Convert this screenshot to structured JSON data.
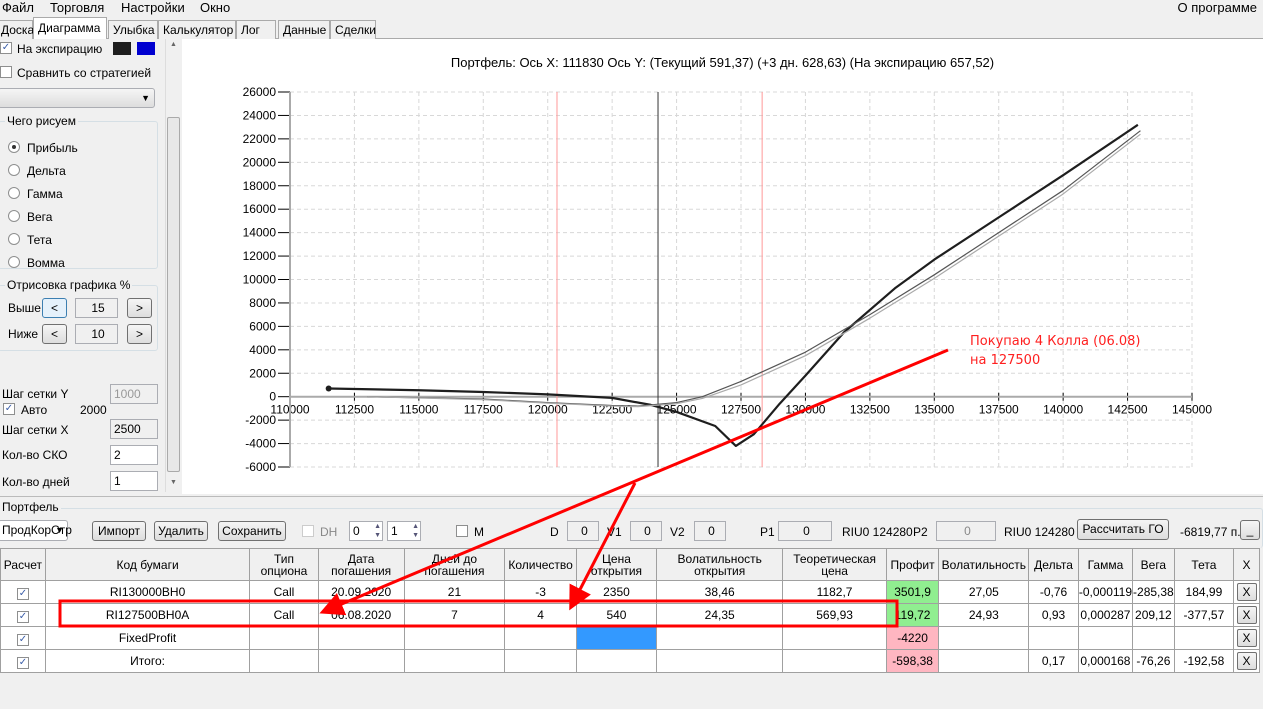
{
  "menu": [
    "Файл",
    "Торговля",
    "Настройки",
    "Окно"
  ],
  "about": "О программе",
  "tabs": [
    "Доска",
    "Диаграмма",
    "Улыбка",
    "Калькулятор",
    "Лог",
    "Данные",
    "Сделки"
  ],
  "active_tab": "Диаграмма",
  "left": {
    "expiration_label": "На экспирацию",
    "expiration_checked": true,
    "colors": [
      "#1e1e1e",
      "#0000d0"
    ],
    "compare_label": "Сравнить со стратегией",
    "compare_checked": false,
    "dropdown_value": "",
    "draw_group": "Чего рисуем",
    "radios": [
      "Прибыль",
      "Дельта",
      "Гамма",
      "Вега",
      "Тета",
      "Вомма"
    ],
    "radio_selected": "Прибыль",
    "render_group": "Отрисовка графика %",
    "above_label": "Выше",
    "above_value": "15",
    "below_label": "Ниже",
    "below_value": "10",
    "prev": "<",
    "next": ">",
    "grid_y_label": "Шаг сетки Y",
    "grid_y_value": "1000",
    "auto_label": "Авто",
    "auto_checked": true,
    "auto_value": "2000",
    "grid_x_label": "Шаг сетки X",
    "grid_x_value": "2500",
    "sko_label": "Кол-во СКО",
    "sko_value": "2",
    "days_label": "Кол-во дней",
    "days_value": "1"
  },
  "chart_data": {
    "type": "line",
    "title": "Портфель: Ось X: 111830 Ось Y:  (Текущий 591,37)  (+3 дн. 628,63)  (На экспирацию 657,52)",
    "xlim": [
      110000,
      145000
    ],
    "ylim": [
      -6000,
      26000
    ],
    "xticks": [
      "110000",
      "112500",
      "115000",
      "117500",
      "120000",
      "122500",
      "125000",
      "127500",
      "130000",
      "132500",
      "135000",
      "137500",
      "140000",
      "142500",
      "145000"
    ],
    "yticks": [
      "26000",
      "24000",
      "22000",
      "20000",
      "18000",
      "16000",
      "14000",
      "12000",
      "10000",
      "8000",
      "6000",
      "4000",
      "2000",
      "0",
      "-2000",
      "-4000",
      "-6000"
    ],
    "grid": true,
    "vlines": [
      {
        "x": 120360,
        "color": "#ff9999"
      },
      {
        "x": 124280,
        "color": "#333333"
      },
      {
        "x": 128320,
        "color": "#ff9999"
      }
    ],
    "series": [
      {
        "color": "#1e1e1e",
        "x": [
          111500,
          115000,
          117500,
          120000,
          122500,
          124000,
          125000,
          126500,
          127300,
          128000,
          129000,
          130000,
          131500,
          133500,
          135000,
          137500,
          140000,
          142900
        ],
        "y": [
          700,
          550,
          400,
          200,
          -100,
          -700,
          -1300,
          -2500,
          -4200,
          -3200,
          -600,
          1800,
          5500,
          9300,
          11700,
          15300,
          18900,
          23200
        ]
      },
      {
        "color": "#555555",
        "x": [
          113000,
          117500,
          120000,
          122500,
          123500,
          125000,
          126000,
          127500,
          130000,
          132500,
          135000,
          137500,
          140000,
          143000
        ],
        "y": [
          0,
          -200,
          -500,
          -750,
          -800,
          -500,
          0,
          1300,
          3800,
          7000,
          10400,
          14000,
          17600,
          22700
        ]
      },
      {
        "color": "#aaaaaa",
        "x": [
          113000,
          117500,
          120000,
          122500,
          123500,
          125000,
          126000,
          127500,
          130000,
          132500,
          135000,
          137500,
          140000,
          143000
        ],
        "y": [
          0,
          -250,
          -550,
          -800,
          -850,
          -600,
          -150,
          1000,
          3500,
          6700,
          10100,
          13700,
          17300,
          22400
        ]
      }
    ],
    "annotation": "Покупаю 4 Колла (06.08)|на 127500"
  },
  "annotation_lines": [
    "Покупаю 4 Колла (06.08)",
    "на 127500"
  ],
  "portfolio": {
    "title": "Портфель",
    "strategy": "ПродКорСтр",
    "import": "Импорт",
    "delete": "Удалить",
    "save": "Сохранить",
    "dh_label": "DH",
    "spin1": "0",
    "spin2": "1",
    "m_label": "M",
    "d_label": "D",
    "d_value": "0",
    "v1_label": "V1",
    "v1_value": "0",
    "v2_label": "V2",
    "v2_value": "0",
    "p1_label": "P1",
    "p1_value": "0",
    "p1_ticker": "RIU0 124280",
    "p2_label": "P2",
    "p2_value": "0",
    "p2_ticker": "RIU0 124280",
    "calc_go": "Рассчитать ГО",
    "go_value": "-6819,77 п.",
    "min_btn": "_"
  },
  "table": {
    "headers": [
      "Расчет",
      "Код бумаги",
      "Тип опциона",
      "Дата погашения",
      "Дней до погашения",
      "Количество",
      "Цена открытия",
      "Волатильность открытия",
      "Теоретическая цена",
      "Профит",
      "Волатильность",
      "Дельта",
      "Гамма",
      "Вега",
      "Тета",
      "X"
    ],
    "rows": [
      {
        "checked": true,
        "cells": [
          "RI130000BH0",
          "Call",
          "20.09.2020",
          "21",
          "-3",
          "2350",
          "38,46",
          "1182,7",
          "3501,9",
          "27,05",
          "-0,76",
          "-0,000119",
          "-285,38",
          "184,99"
        ],
        "profit": "green"
      },
      {
        "checked": true,
        "cells": [
          "RI127500BH0A",
          "Call",
          "06.08.2020",
          "7",
          "4",
          "540",
          "24,35",
          "569,93",
          "119,72",
          "24,93",
          "0,93",
          "0,000287",
          "209,12",
          "-377,57"
        ],
        "profit": "green"
      },
      {
        "checked": true,
        "cells": [
          "FixedProfit",
          "",
          "",
          "",
          "",
          "",
          "",
          "",
          "-4220",
          "",
          "",
          "",
          "",
          ""
        ],
        "profit": "pink"
      },
      {
        "checked": true,
        "cells": [
          "Итого:",
          "",
          "",
          "",
          "",
          "",
          "",
          "",
          "-598,38",
          "",
          "0,17",
          "0,000168",
          "-76,26",
          "-192,58"
        ],
        "profit": "pink"
      }
    ],
    "x_label": "X"
  }
}
